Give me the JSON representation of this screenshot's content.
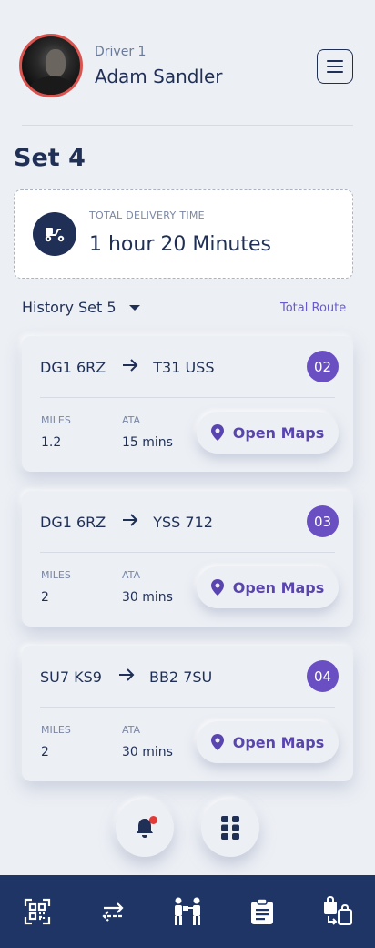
{
  "header": {
    "driver_label": "Driver 1",
    "driver_name": "Adam Sandler",
    "avatar_border_color": "#d9534f"
  },
  "set_title": "Set 4",
  "total_delivery": {
    "label": "TOTAL DELIVERY TIME",
    "value": "1 hour 20 Minutes",
    "icon": "scooter-icon"
  },
  "history": {
    "label": "History Set 5",
    "total_route_link": "Total Route"
  },
  "routes": [
    {
      "from": "DG1 6RZ",
      "to": "T31 USS",
      "number": "02",
      "miles_label": "MILES",
      "miles": "1.2",
      "ata_label": "ATA",
      "ata": "15 mins",
      "maps_label": "Open Maps"
    },
    {
      "from": "DG1 6RZ",
      "to": "YSS 712",
      "number": "03",
      "miles_label": "MILES",
      "miles": "2",
      "ata_label": "ATA",
      "ata": "30 mins",
      "maps_label": "Open Maps"
    },
    {
      "from": "SU7 KS9",
      "to": "BB2 7SU",
      "number": "04",
      "miles_label": "MILES",
      "miles": "2",
      "ata_label": "ATA",
      "ata": "30 mins",
      "maps_label": "Open Maps"
    }
  ],
  "bottom_nav": {
    "items": [
      "qr-code-icon",
      "transfer-icon",
      "delivery-person-icon",
      "clipboard-icon",
      "bag-exchange-icon"
    ]
  },
  "colors": {
    "primary": "#1f2f55",
    "accent": "#6a4fc2",
    "nav_bg": "#1f3566",
    "notification": "#e53935"
  }
}
